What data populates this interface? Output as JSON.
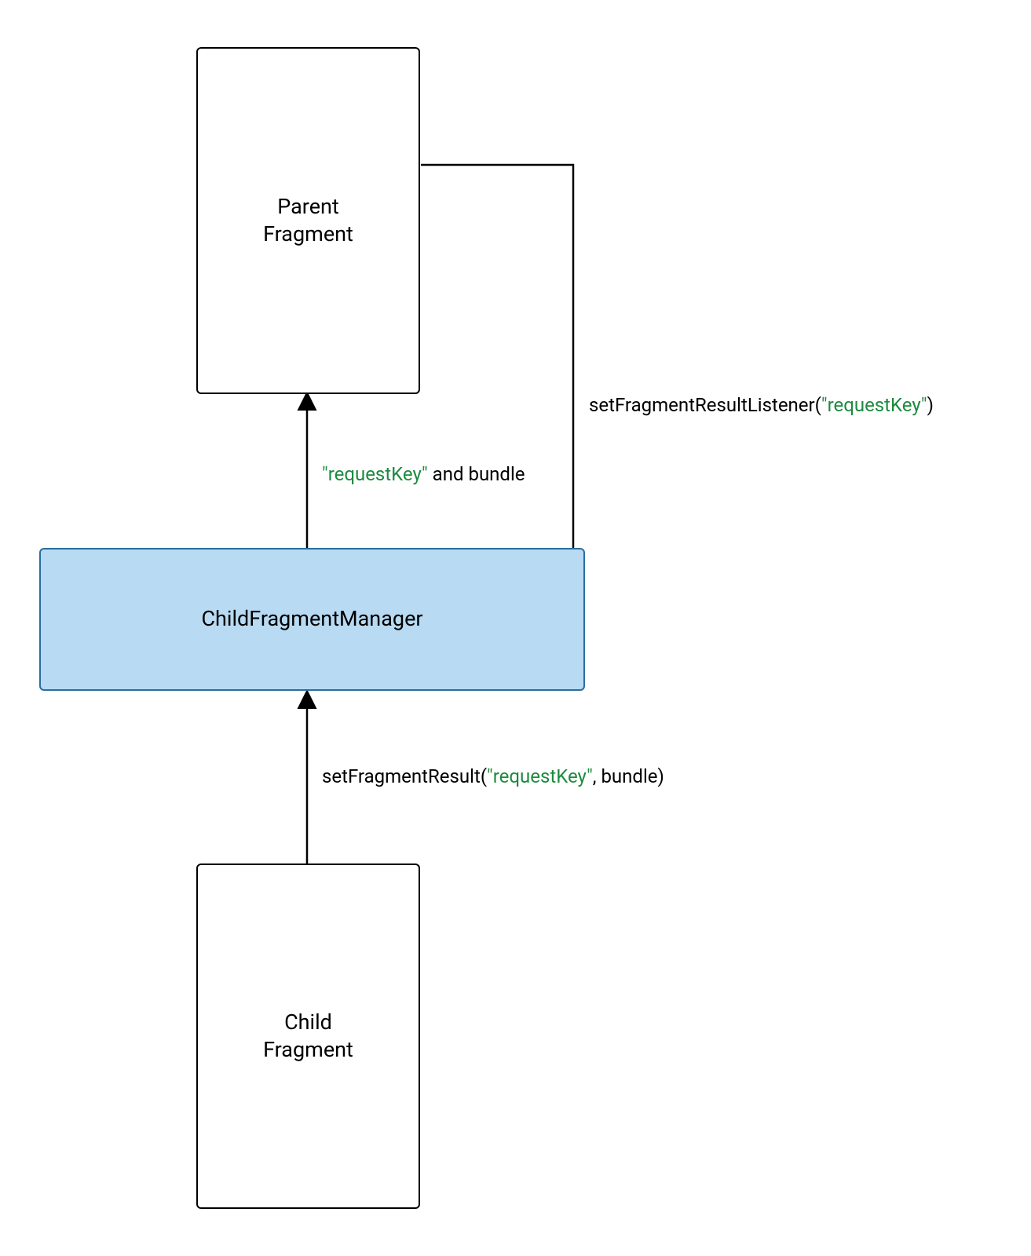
{
  "nodes": {
    "parent": {
      "line1": "Parent",
      "line2": "Fragment"
    },
    "manager": {
      "label": "ChildFragmentManager"
    },
    "child": {
      "line1": "Child",
      "line2": "Fragment"
    }
  },
  "edges": {
    "listener": {
      "prefix": "setFragmentResultListener(",
      "key": "\"requestKey\"",
      "suffix": ")"
    },
    "bundle_up": {
      "key": "\"requestKey\"",
      "suffix": " and bundle"
    },
    "set_result": {
      "prefix": "setFragmentResult(",
      "key": "\"requestKey\"",
      "suffix": ", bundle)"
    }
  },
  "colors": {
    "key_color": "#1d8a3f",
    "manager_fill": "#b8daf2",
    "manager_border": "#2a6e9e"
  }
}
